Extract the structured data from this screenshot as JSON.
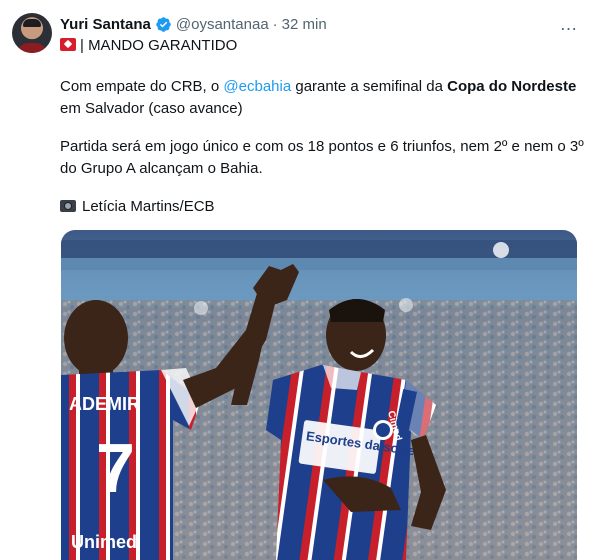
{
  "tweet": {
    "author_name": "Yuri Santana",
    "handle": "@oysantanaa",
    "separator": "·",
    "time": "32 min",
    "more_icon": "…",
    "headline": "| MANDO GARANTIDO",
    "para1_start": "Com empate do CRB, o ",
    "mention": "@ecbahia",
    "para1_mid": " garante a semifinal da ",
    "para1_bold": "Copa do Nordeste",
    "para1_end": " em Salvador (caso avance)",
    "para2": "Partida será em jogo único e com os 18 pontos e 6 triunfos, nem 2º e nem o 3º do Grupo A alcançam o Bahia.",
    "credit": "Letícia Martins/ECB"
  },
  "media": {
    "jersey_name": "ADEMIR",
    "jersey_number": "7",
    "sponsor_left": "Unimed",
    "sponsor_right": "Esportes da sorte",
    "sleeve_brand": "Cimed"
  },
  "colors": {
    "accent": "#1d9bf0",
    "text": "#0f1419",
    "muted": "#536471",
    "bahia_blue": "#1d3f8c",
    "bahia_red": "#c8202b"
  }
}
